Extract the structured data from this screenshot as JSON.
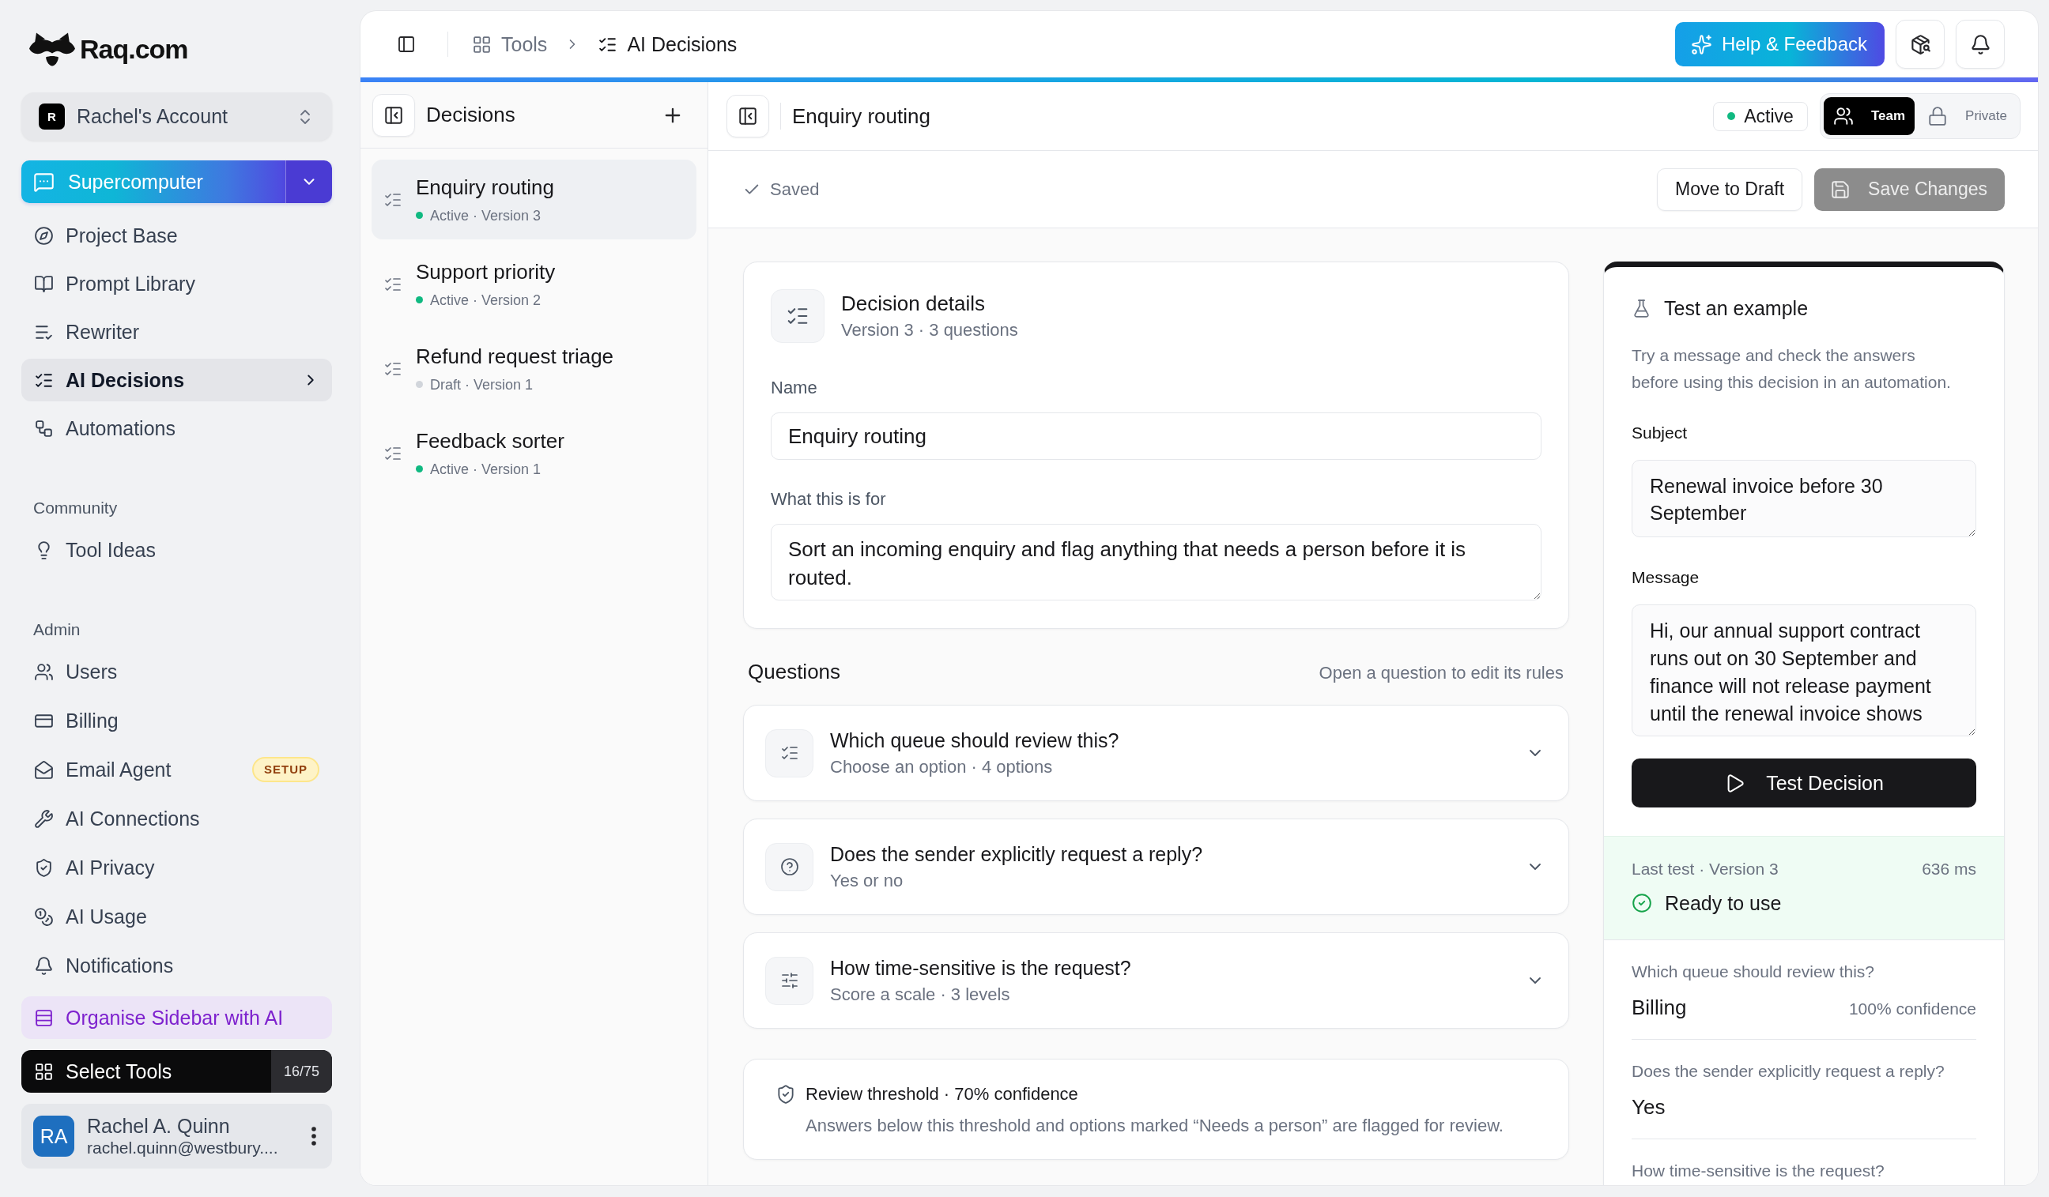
{
  "sidebar": {
    "logo": "Raq.com",
    "account": {
      "initial": "R",
      "name": "Rachel's Account"
    },
    "primary_tool": "Supercomputer",
    "nav": [
      {
        "label": "Project Base",
        "selected": false
      },
      {
        "label": "Prompt Library",
        "selected": false
      },
      {
        "label": "Rewriter",
        "selected": false
      },
      {
        "label": "AI Decisions",
        "selected": true
      },
      {
        "label": "Automations",
        "selected": false
      }
    ],
    "sections": [
      {
        "heading": "Community",
        "items": [
          {
            "label": "Tool Ideas",
            "selected": false
          }
        ]
      },
      {
        "heading": "Admin",
        "items": [
          {
            "label": "Users",
            "selected": false
          },
          {
            "label": "Billing",
            "selected": false
          },
          {
            "label": "Email Agent",
            "selected": false,
            "badge": "SETUP"
          },
          {
            "label": "AI Connections",
            "selected": false
          },
          {
            "label": "AI Privacy",
            "selected": false
          },
          {
            "label": "AI Usage",
            "selected": false
          },
          {
            "label": "Notifications",
            "selected": false
          }
        ]
      }
    ],
    "organise_button": "Organise Sidebar with AI",
    "select_tools": {
      "label": "Select Tools",
      "count": "16/75"
    },
    "user": {
      "initials": "RA",
      "name": "Rachel A. Quinn",
      "email": "rachel.quinn@westbury...."
    }
  },
  "topbar": {
    "breadcrumbs": [
      {
        "label": "Tools",
        "current": false
      },
      {
        "label": "AI Decisions",
        "current": true
      }
    ],
    "help_button": "Help & Feedback"
  },
  "decisions_panel": {
    "title": "Decisions",
    "items": [
      {
        "name": "Enquiry routing",
        "status": "Active · Version 3",
        "color": "#10b981",
        "selected": true
      },
      {
        "name": "Support priority",
        "status": "Active · Version 2",
        "color": "#10b981",
        "selected": false
      },
      {
        "name": "Refund request triage",
        "status": "Draft · Version 1",
        "color": "#d1d5db",
        "selected": false
      },
      {
        "name": "Feedback sorter",
        "status": "Active · Version 1",
        "color": "#10b981",
        "selected": false
      }
    ]
  },
  "detail": {
    "title": "Enquiry routing",
    "status": "Active",
    "visibility": [
      {
        "label": "Team",
        "selected": true
      },
      {
        "label": "Private",
        "selected": false
      }
    ],
    "save_status": "Saved",
    "draft_button": "Move to Draft",
    "save_button": {
      "label": "Save Changes",
      "disabled": true
    },
    "details_card": {
      "title": "Decision details",
      "subtitle": "Version 3 · 3 questions",
      "fields": [
        {
          "kind": "input",
          "label": "Name",
          "value": "Enquiry routing"
        },
        {
          "kind": "textarea",
          "label": "What this is for",
          "value": "Sort an incoming enquiry and flag anything that needs a person before it is routed."
        }
      ]
    },
    "questions": {
      "heading": "Questions",
      "hint": "Open a question to edit its rules",
      "items": [
        {
          "kind": "choice",
          "title": "Which queue should review this?",
          "subtitle": "Choose an option · 4 options"
        },
        {
          "kind": "yes_no",
          "title": "Does the sender explicitly request a reply?",
          "subtitle": "Yes or no"
        },
        {
          "kind": "scale",
          "title": "How time-sensitive is the request?",
          "subtitle": "Score a scale · 3 levels"
        }
      ]
    },
    "threshold": {
      "title": "Review threshold · 70% confidence",
      "text": "Answers below this threshold and options marked “Needs a person” are flagged for review."
    }
  },
  "test_panel": {
    "title": "Test an example",
    "description": "Try a message and check the answers before using this decision in an automation.",
    "fields": [
      {
        "label": "Subject",
        "value": "Renewal invoice before 30 September"
      },
      {
        "label": "Message",
        "value": "Hi, our annual support contract runs out on 30 September and finance will not release payment until the renewal invoice shows"
      }
    ],
    "run_button": "Test Decision",
    "last_test": {
      "label": "Last test · Version 3",
      "duration": "636 ms",
      "result": "Ready to use"
    },
    "answers": [
      {
        "question": "Which queue should review this?",
        "answer": "Billing",
        "confidence": "100% confidence"
      },
      {
        "question": "Does the sender explicitly request a reply?",
        "answer": "Yes"
      },
      {
        "question": "How time-sensitive is the request?"
      }
    ]
  }
}
